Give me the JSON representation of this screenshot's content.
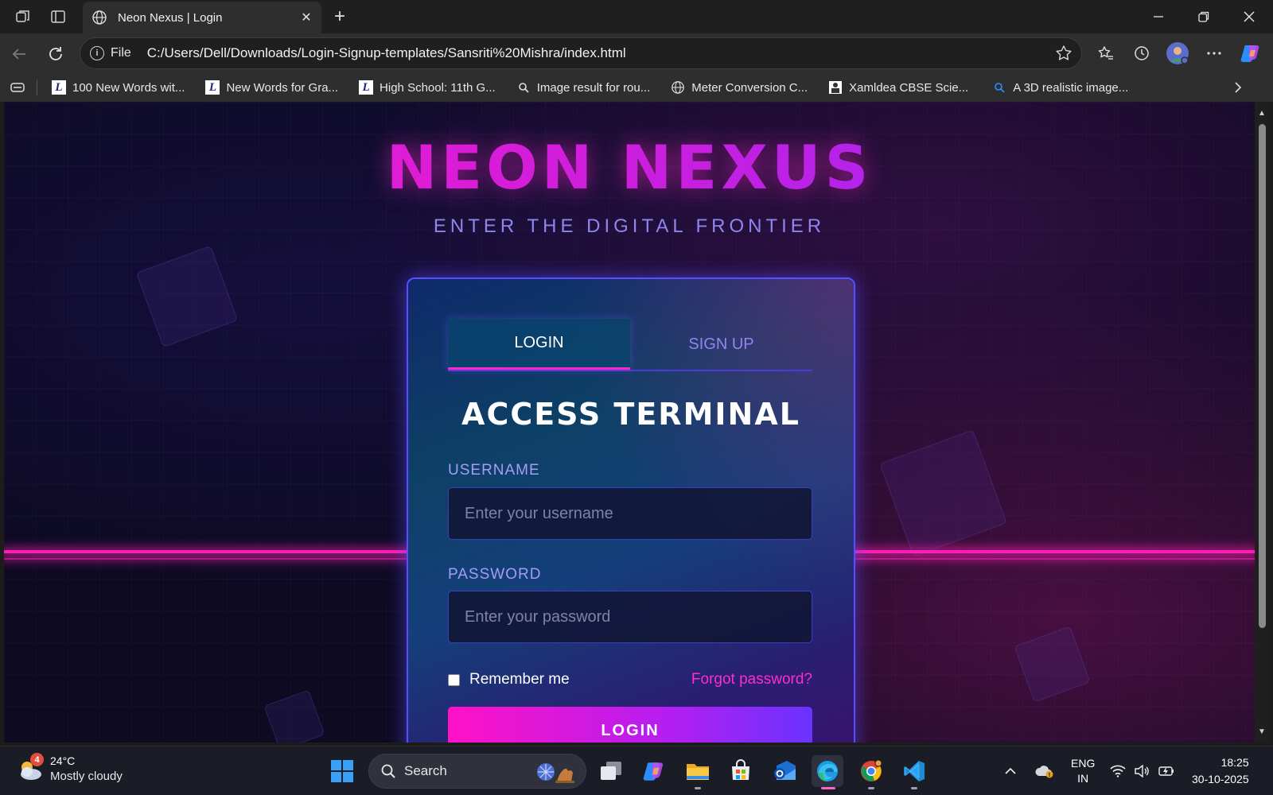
{
  "browser": {
    "tab": {
      "title": "Neon Nexus | Login"
    },
    "address": {
      "scheme": "File",
      "url": "C:/Users/Dell/Downloads/Login-Signup-templates/Sansriti%20Mishra/index.html"
    },
    "favorites": [
      {
        "label": "100 New Words wit...",
        "icon": "letter-l-icon"
      },
      {
        "label": "New Words for Gra...",
        "icon": "letter-l-icon"
      },
      {
        "label": "High School: 11th G...",
        "icon": "letter-l-icon"
      },
      {
        "label": "Image result for rou...",
        "icon": "search-icon"
      },
      {
        "label": "Meter Conversion C...",
        "icon": "globe-icon"
      },
      {
        "label": "Xamldea CBSE Scie...",
        "icon": "book-icon"
      },
      {
        "label": "A 3D realistic image...",
        "icon": "search-icon"
      }
    ]
  },
  "page": {
    "brand": "NEON NEXUS",
    "tagline": "ENTER THE DIGITAL FRONTIER",
    "tabs": {
      "login": "LOGIN",
      "signup": "SIGN UP"
    },
    "heading": "ACCESS TERMINAL",
    "username": {
      "label": "USERNAME",
      "placeholder": "Enter your username"
    },
    "password": {
      "label": "PASSWORD",
      "placeholder": "Enter your password"
    },
    "remember_label": "Remember me",
    "forgot_label": "Forgot password?",
    "submit_label": "LOGIN",
    "colors": {
      "accent_pink": "#ff17c8",
      "accent_purple": "#8c2cff",
      "tagline": "#8e86ee"
    }
  },
  "taskbar": {
    "weather": {
      "badge": "4",
      "temp": "24°C",
      "desc": "Mostly cloudy"
    },
    "search_label": "Search",
    "lang": {
      "line1": "ENG",
      "line2": "IN"
    },
    "clock": {
      "time": "18:25",
      "date": "30-10-2025"
    }
  }
}
